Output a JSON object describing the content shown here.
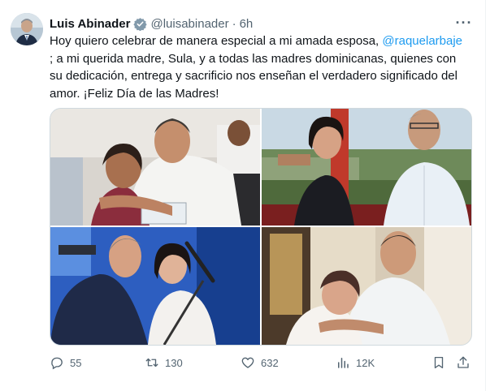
{
  "tweet": {
    "author_name": "Luis Abinader",
    "handle": "@luisabinader",
    "separator": "·",
    "time": "6h",
    "more_label": "···",
    "text_part1": "Hoy quiero celebrar de manera especial a mi amada esposa, ",
    "mention": "@raquelarbaje",
    "text_line2": "; a mi querida madre, Sula, y a todas las madres dominicanas, quienes con",
    "text_line3": "su dedicación, entrega y sacrificio nos enseñan el verdadero significado del",
    "text_line4": "amor. ¡Feliz Día de las Madres!"
  },
  "media": {
    "photos": [
      {
        "icon": "photo-1-abinader-hugging-mother"
      },
      {
        "icon": "photo-2-abinader-with-wife"
      },
      {
        "icon": "photo-3-abinader-embrace-at-podium"
      },
      {
        "icon": "photo-4-abinader-hugging-mother-indoors"
      }
    ]
  },
  "actions": {
    "replies": "55",
    "reposts": "130",
    "likes": "632",
    "views": "12K"
  },
  "colors": {
    "accent": "#1d9bf0",
    "text": "#0f1419",
    "muted": "#536471",
    "border": "#cfd9de"
  }
}
